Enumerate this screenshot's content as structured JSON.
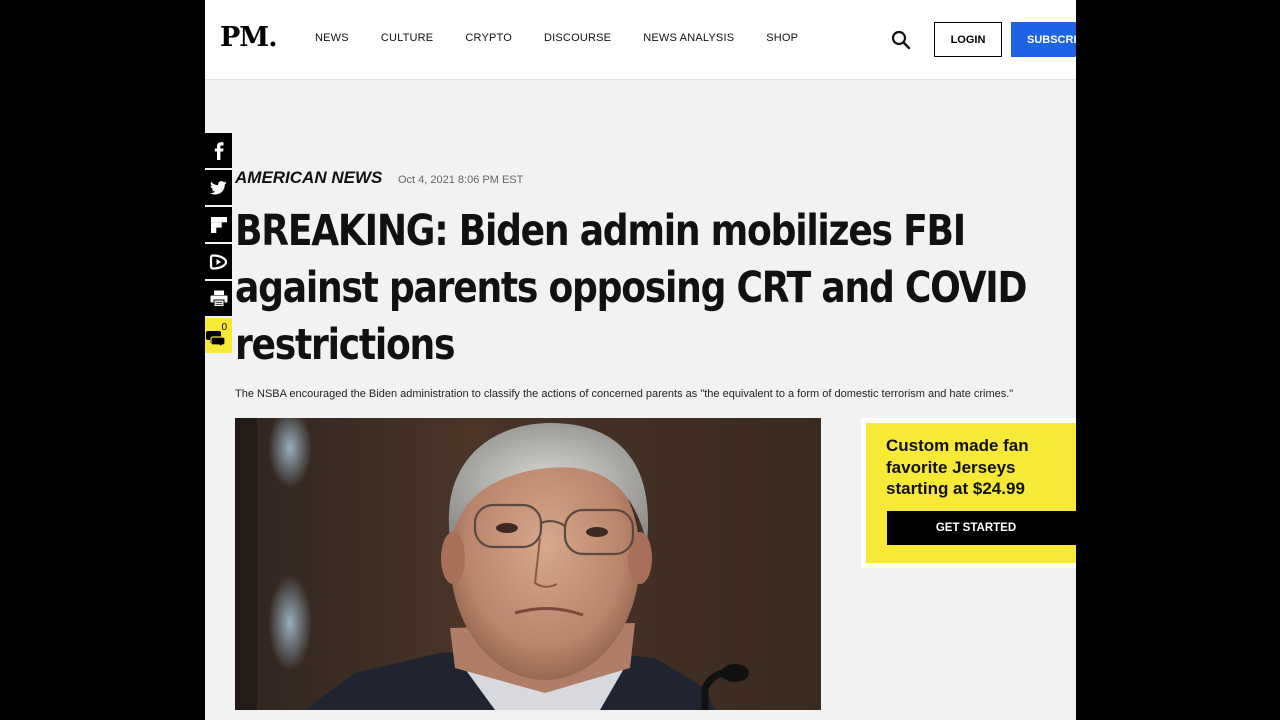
{
  "site": {
    "logo": "PM.",
    "nav": [
      "NEWS",
      "CULTURE",
      "CRYPTO",
      "DISCOURSE",
      "NEWS ANALYSIS",
      "SHOP"
    ],
    "login_label": "LOGIN",
    "subscribe_label": "SUBSCRIBE"
  },
  "share": {
    "buttons": [
      "facebook-icon",
      "twitter-icon",
      "flipboard-icon",
      "rumble-icon",
      "print-icon",
      "comment-icon"
    ],
    "comment_count": "0"
  },
  "article": {
    "category": "AMERICAN NEWS",
    "date": "Oct 4, 2021 8:06 PM EST",
    "headline_lines": [
      "BREAKING: Biden admin mobilizes FBI",
      "against parents opposing CRT and COVID",
      "restrictions"
    ],
    "subtitle": "The NSBA encouraged the Biden administration to classify the actions of concerned parents as \"the equivalent to a form of domestic terrorism and hate crimes.\""
  },
  "ad": {
    "text_lines": [
      "Custom made fan",
      "favorite Jerseys",
      "starting at $24.99"
    ],
    "cta": "GET STARTED",
    "color": "#f8e937"
  },
  "colors": {
    "subscribe": "#1e63e4",
    "page_bg": "#f2f2f2"
  }
}
